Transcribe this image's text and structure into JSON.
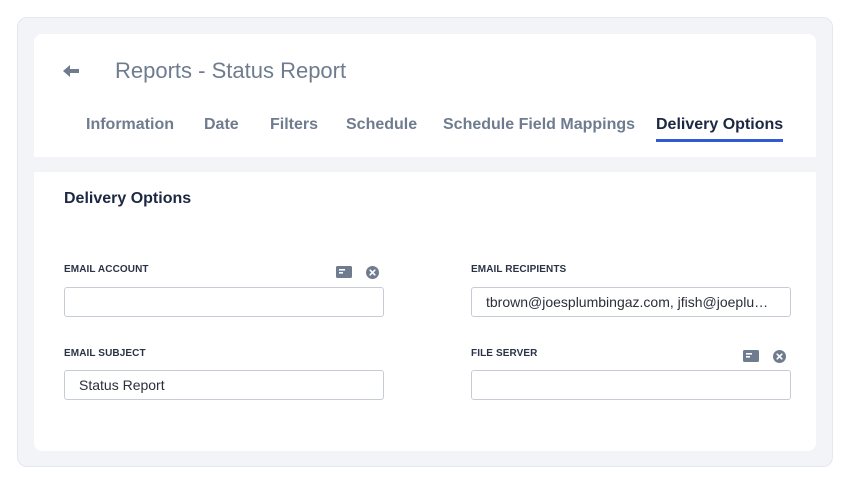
{
  "header": {
    "title": "Reports - Status Report",
    "tabs": [
      {
        "label": "Information"
      },
      {
        "label": "Date"
      },
      {
        "label": "Filters"
      },
      {
        "label": "Schedule"
      },
      {
        "label": "Schedule Field Mappings"
      },
      {
        "label": "Delivery Options"
      }
    ],
    "active_tab": "Delivery Options",
    "accent_color": "#2f5bd3"
  },
  "section": {
    "title": "Delivery Options",
    "fields": {
      "email_account": {
        "label": "EMAIL ACCOUNT",
        "value": ""
      },
      "email_recipients": {
        "label": "EMAIL RECIPIENTS",
        "value": "tbrown@joesplumbingaz.com, jfish@joeplu…"
      },
      "email_subject": {
        "label": "EMAIL SUBJECT",
        "value": "Status Report"
      },
      "file_server": {
        "label": "FILE SERVER",
        "value": ""
      }
    }
  },
  "icons": [
    "back-arrow-icon",
    "card-icon",
    "clear-icon"
  ]
}
